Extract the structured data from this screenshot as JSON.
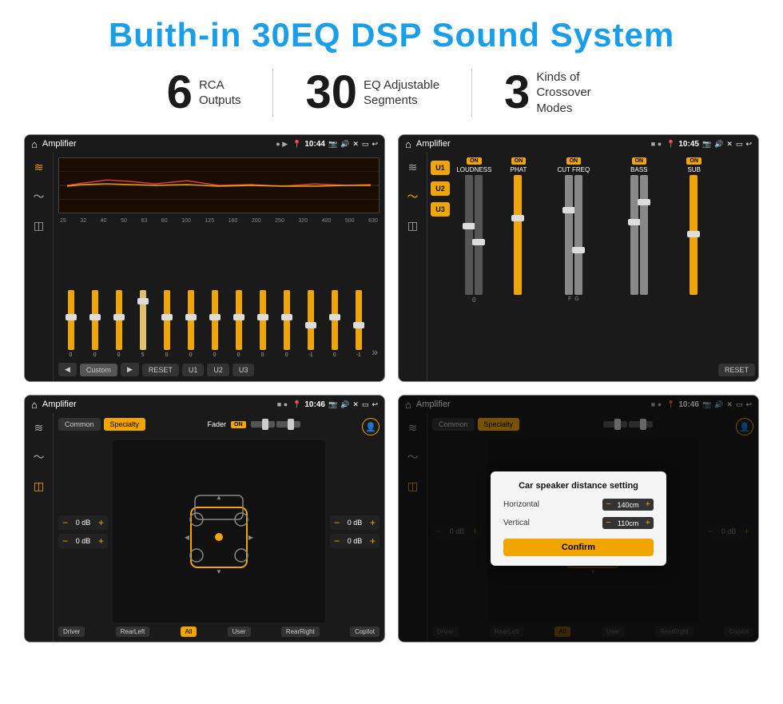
{
  "header": {
    "title": "Buith-in 30EQ DSP Sound System"
  },
  "stats": [
    {
      "number": "6",
      "label": "RCA\nOutputs"
    },
    {
      "number": "30",
      "label": "EQ Adjustable\nSegments"
    },
    {
      "number": "3",
      "label": "Kinds of\nCrossover Modes"
    }
  ],
  "screens": {
    "eq": {
      "app_title": "Amplifier",
      "time": "10:44",
      "freq_labels": [
        "25",
        "32",
        "40",
        "50",
        "63",
        "80",
        "100",
        "125",
        "160",
        "200",
        "250",
        "320",
        "400",
        "500",
        "630"
      ],
      "slider_values": [
        "0",
        "0",
        "0",
        "5",
        "0",
        "0",
        "0",
        "0",
        "0",
        "0",
        "-1",
        "0",
        "-1"
      ],
      "buttons": [
        "Custom",
        "RESET",
        "U1",
        "U2",
        "U3"
      ]
    },
    "crossover": {
      "app_title": "Amplifier",
      "time": "10:45",
      "u_labels": [
        "U1",
        "U2",
        "U3"
      ],
      "col_labels": [
        "LOUDNESS",
        "PHAT",
        "CUT FREQ",
        "BASS",
        "SUB"
      ],
      "on_labels": [
        "ON",
        "ON",
        "ON",
        "ON",
        "ON"
      ],
      "reset_label": "RESET"
    },
    "fader": {
      "app_title": "Amplifier",
      "time": "10:46",
      "tabs": [
        "Common",
        "Specialty"
      ],
      "fader_label": "Fader",
      "fader_on": "ON",
      "vol_values": [
        "0 dB",
        "0 dB",
        "0 dB",
        "0 dB"
      ],
      "bottom_btns": [
        "Driver",
        "RearLeft",
        "All",
        "User",
        "RearRight",
        "Copilot"
      ]
    },
    "distance": {
      "app_title": "Amplifier",
      "time": "10:46",
      "tabs": [
        "Common",
        "Specialty"
      ],
      "dialog_title": "Car speaker distance setting",
      "horizontal_label": "Horizontal",
      "horizontal_val": "140cm",
      "vertical_label": "Vertical",
      "vertical_val": "110cm",
      "confirm_label": "Confirm",
      "bottom_btns": [
        "Driver",
        "RearLeft",
        "All",
        "User",
        "RearRight",
        "Copilot"
      ],
      "vol_values": [
        "0 dB",
        "0 dB"
      ]
    }
  }
}
